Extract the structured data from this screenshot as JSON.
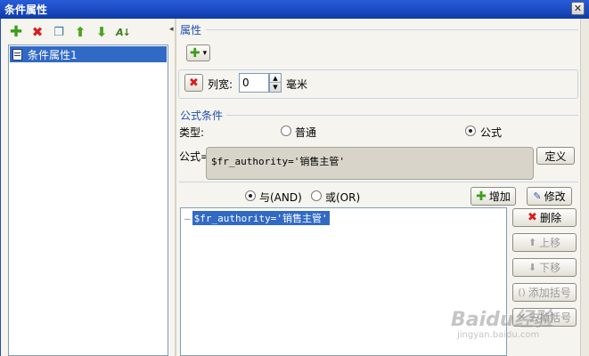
{
  "window": {
    "title": "条件属性",
    "close_glyph": "✕"
  },
  "toolbar": {
    "icons": [
      "add-icon",
      "delete-icon",
      "copy-icon",
      "move-up-icon",
      "move-down-icon",
      "sort-icon"
    ],
    "collapse_arrow": "◂"
  },
  "tree": {
    "items": [
      {
        "label": "条件属性1"
      }
    ]
  },
  "properties": {
    "group_label": "属性",
    "add_dropdown_arrow": "▾",
    "column_width_label": "列宽:",
    "column_width_value": "0",
    "unit": "毫米"
  },
  "formula_condition": {
    "group_label": "公式条件",
    "type_label": "类型:",
    "options": [
      {
        "label": "普通",
        "selected": false
      },
      {
        "label": "公式",
        "selected": true
      }
    ],
    "formula_label": "公式=",
    "formula_value": "$fr_authority='销售主管'",
    "define_button": "定义"
  },
  "logic": {
    "and_label": "与(AND)",
    "or_label": "或(OR)",
    "and_selected": true,
    "add_button": "增加",
    "modify_button": "修改"
  },
  "condition_list": {
    "items": [
      {
        "prefix": "—",
        "text": "$fr_authority='销售主管'"
      }
    ]
  },
  "side_buttons": {
    "delete": "删除",
    "move_up": "上移",
    "move_down": "下移",
    "add_bracket": "添加括号",
    "remove_bracket": "去掉括号"
  },
  "watermark": {
    "text": "Baidu经验",
    "sub": "jingyan.baidu.com"
  },
  "colors": {
    "title_bar": "#1d4ec7",
    "selection": "#316ac5",
    "group_label": "#1e4fb3"
  }
}
